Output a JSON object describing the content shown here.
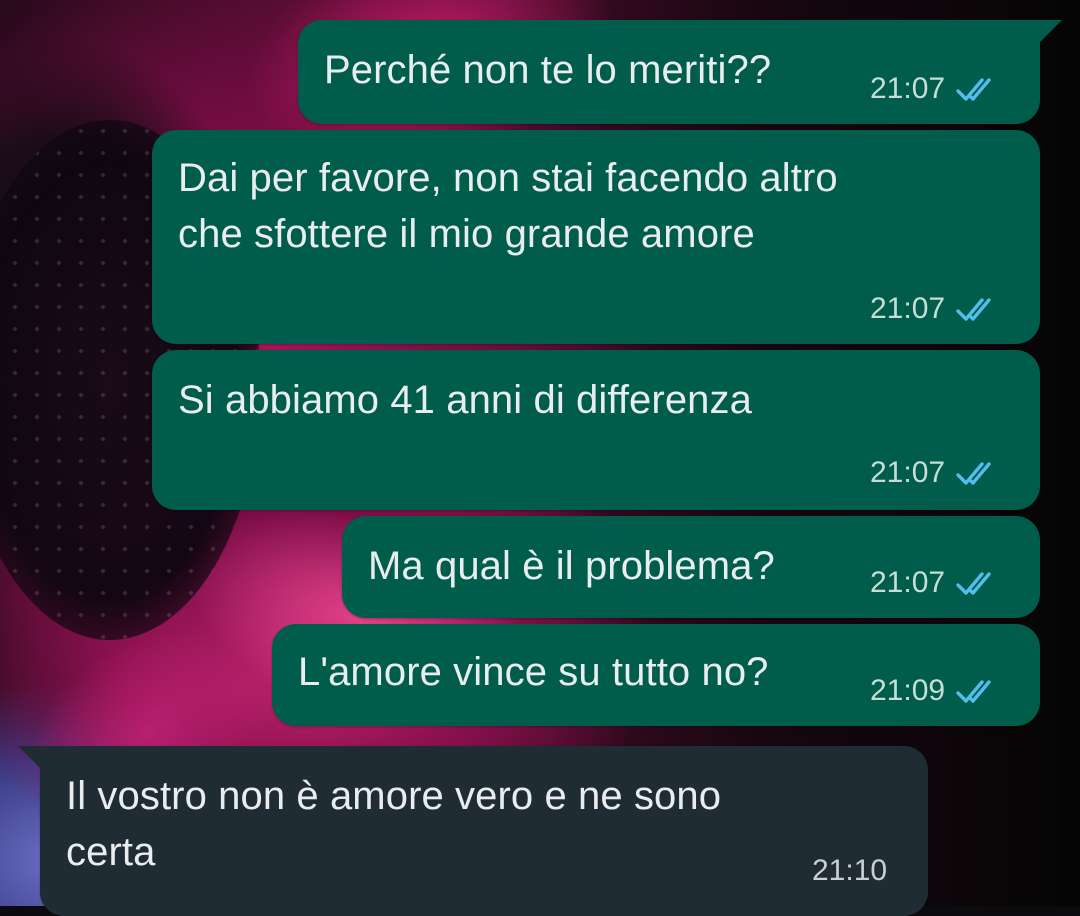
{
  "messages": [
    {
      "direction": "sent",
      "text": "Perché non te lo meriti??",
      "time": "21:07",
      "status": "read",
      "status_icon": "double-check-icon"
    },
    {
      "direction": "sent",
      "lines": [
        "Dai per favore, non stai facendo altro",
        "che sfottere il mio grande amore"
      ],
      "time": "21:07",
      "status": "read",
      "status_icon": "double-check-icon"
    },
    {
      "direction": "sent",
      "text": "Si abbiamo 41 anni di differenza",
      "time": "21:07",
      "status": "read",
      "status_icon": "double-check-icon"
    },
    {
      "direction": "sent",
      "text": "Ma qual è il problema?",
      "time": "21:07",
      "status": "read",
      "status_icon": "double-check-icon"
    },
    {
      "direction": "sent",
      "text": "L'amore vince su tutto no?",
      "time": "21:09",
      "status": "read",
      "status_icon": "double-check-icon"
    },
    {
      "direction": "received",
      "lines": [
        "Il vostro non è amore vero e ne sono",
        "certa"
      ],
      "time": "21:10"
    }
  ],
  "colors": {
    "sent_bubble": "#005c4b",
    "received_bubble": "#202c33",
    "text": "#e9edef",
    "read_tick": "#53bdeb"
  }
}
